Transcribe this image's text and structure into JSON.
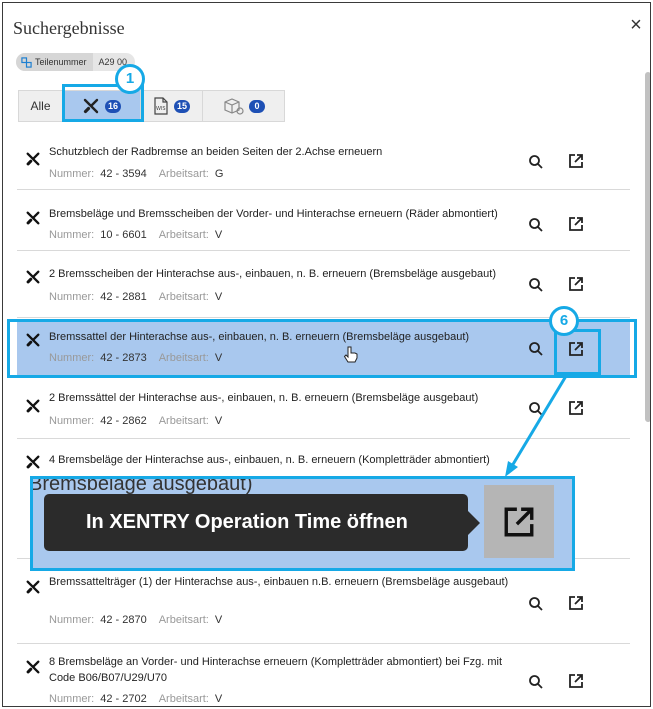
{
  "dialog": {
    "title": "Suchergebnisse",
    "close_symbol": "×"
  },
  "filter_chip": {
    "label": "Teilenummer",
    "value": "A29   00"
  },
  "tabs": [
    {
      "label": "Alle",
      "icon": null,
      "count": null
    },
    {
      "label": "",
      "icon": "wrench-screwdriver-icon",
      "count": "16"
    },
    {
      "label": "",
      "icon": "wis-document-icon",
      "count": "15"
    },
    {
      "label": "",
      "icon": "parts-box-icon",
      "count": "0"
    }
  ],
  "callouts": {
    "step_1": "1",
    "step_6": "6"
  },
  "results": {
    "number_label": "Nummer:",
    "type_label": "Arbeitsart:",
    "items": [
      {
        "name": "Schutzblech der Radbremse an beiden Seiten der 2.Achse erneuern",
        "number": "42 - 3594",
        "type": "G"
      },
      {
        "name": "Bremsbeläge und Bremsscheiben der Vorder- und Hinterachse erneuern (Räder abmontiert)",
        "number": "10 - 6601",
        "type": "V"
      },
      {
        "name": "2 Bremsscheiben der Hinterachse aus-, einbauen, n. B. erneuern (Bremsbeläge ausgebaut)",
        "number": "42 - 2881",
        "type": "V"
      },
      {
        "name": "Bremssattel der Hinterachse aus-, einbauen, n. B. erneuern (Bremsbeläge ausgebaut)",
        "number": "42 - 2873",
        "type": "V"
      },
      {
        "name": "2 Bremssättel der Hinterachse aus-, einbauen, n. B. erneuern (Bremsbeläge ausgebaut)",
        "number": "42 - 2862",
        "type": "V"
      },
      {
        "name": "4 Bremsbeläge der Hinterachse aus-, einbauen, n. B. erneuern (Kompletträder abmontiert)",
        "number": "",
        "type": ""
      },
      {
        "name": "Bremssattelträger (1) der Hinterachse aus-, einbauen n.B. erneuern (Bremsbeläge ausgebaut)",
        "number": "42 - 2870",
        "type": "V"
      },
      {
        "name": "8 Bremsbeläge an Vorder- und Hinterachse erneuern (Kompletträder abmontiert) bei Fzg. mit Code B06/B07/U29/U70",
        "number": "42 - 2702",
        "type": "V"
      }
    ]
  },
  "zoom_callout": {
    "background_text": "Bremsbeläge ausgebaut)",
    "tooltip": "In XENTRY Operation Time öffnen"
  },
  "colors": {
    "highlight": "#16a9e6",
    "selected_row": "#a9c8ee",
    "badge": "#1e50b5",
    "tooltip_bg": "#2b2b2b"
  }
}
